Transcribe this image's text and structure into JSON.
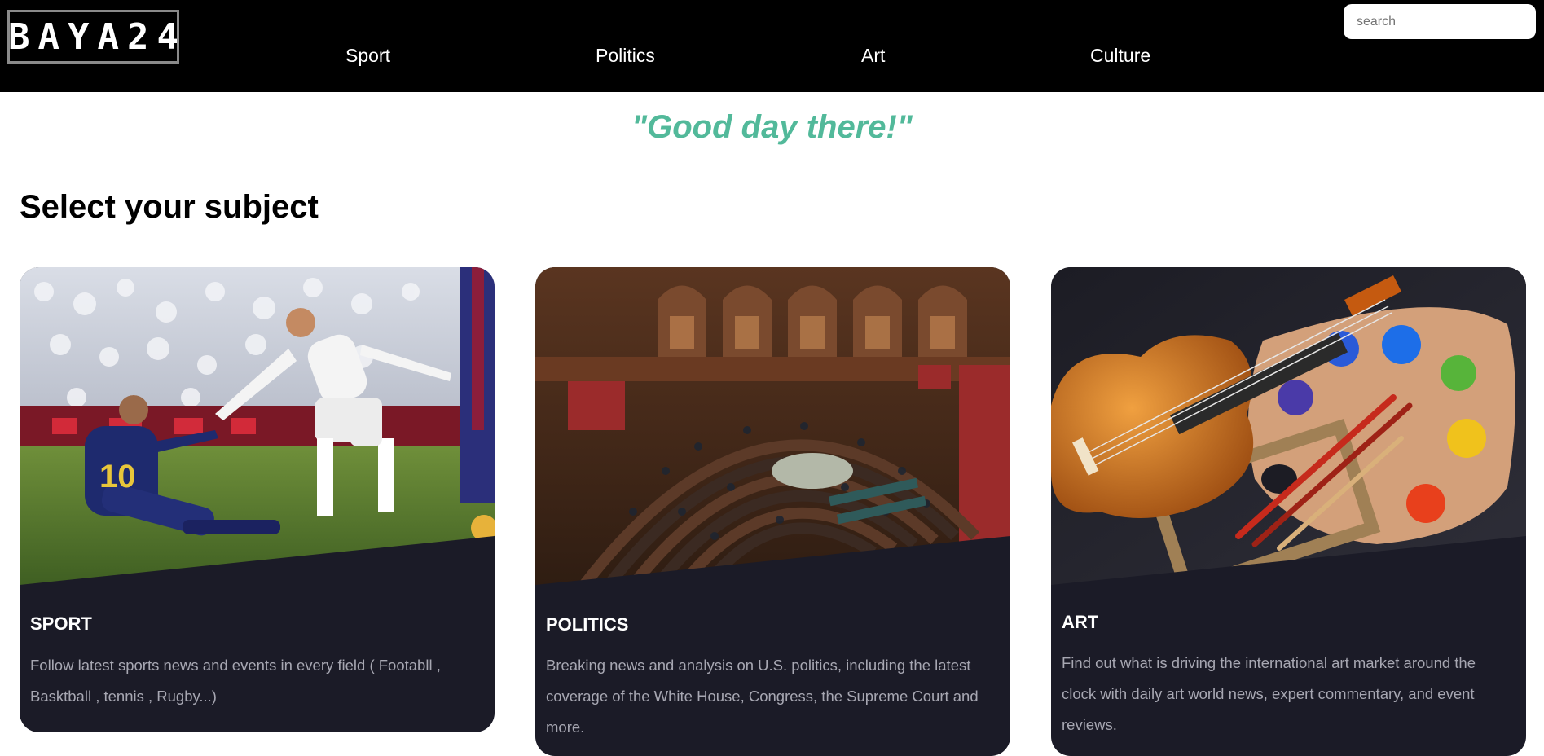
{
  "header": {
    "logo_text": "BAYA24",
    "nav": [
      {
        "label": "Sport"
      },
      {
        "label": "Politics"
      },
      {
        "label": "Art"
      },
      {
        "label": "Culture"
      }
    ],
    "search": {
      "placeholder": "search",
      "value": ""
    }
  },
  "main": {
    "greeting": "\"Good day there!\"",
    "section_title": "Select your subject",
    "cards": [
      {
        "title": "SPORT",
        "text": "Follow latest sports news and events in every field ( Footabll , Basktball , tennis , Rugby...)",
        "image": "football-players-photo"
      },
      {
        "title": "POLITICS",
        "text": "Breaking news and analysis on U.S. politics, including the latest coverage of the White House, Congress, the Supreme Court and more.",
        "image": "parliament-chamber-photo"
      },
      {
        "title": "ART",
        "text": "Find out what is driving the international art market around the clock with daily art world news, expert commentary, and event reviews.",
        "image": "violin-and-palette-photo"
      }
    ]
  },
  "colors": {
    "header_bg": "#000000",
    "accent": "#52b99a",
    "card_bg": "#1b1b27",
    "card_text": "#a7a7b2"
  }
}
